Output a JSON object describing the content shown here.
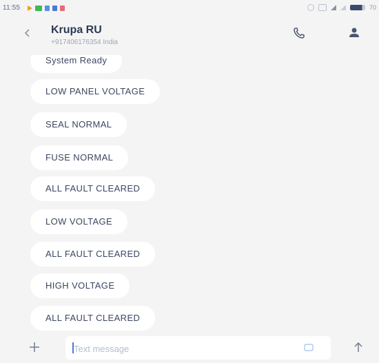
{
  "status_bar": {
    "time": "11:55",
    "battery_level": "70"
  },
  "header": {
    "contact_name": "Krupa RU",
    "contact_subtitle": "+917406176354 India",
    "back_icon": "chevron-left-icon",
    "call_icon": "phone-icon",
    "contact_icon": "person-icon"
  },
  "messages": [
    {
      "text": "System Ready"
    },
    {
      "text": "LOW PANEL VOLTAGE"
    },
    {
      "text": "SEAL NORMAL"
    },
    {
      "text": "FUSE NORMAL"
    },
    {
      "text": "ALL FAULT CLEARED"
    },
    {
      "text": "LOW VOLTAGE"
    },
    {
      "text": "ALL FAULT CLEARED"
    },
    {
      "text": "HIGH VOLTAGE"
    },
    {
      "text": "ALL FAULT CLEARED"
    }
  ],
  "composer": {
    "placeholder": "Text message",
    "add_icon": "plus-icon",
    "emoji_icon": "emoji-icon",
    "send_icon": "arrow-up-icon"
  },
  "colors": {
    "background": "#f4f4f4",
    "bubble": "#ffffff",
    "text": "#3a4660",
    "accent": "#4a7ad8"
  }
}
